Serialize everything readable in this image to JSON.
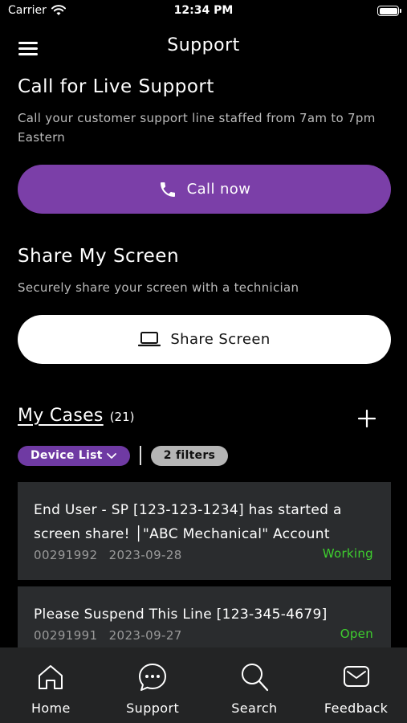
{
  "status_bar": {
    "carrier": "Carrier",
    "time": "12:34 PM"
  },
  "nav": {
    "title": "Support"
  },
  "live_support": {
    "title": "Call for Live Support",
    "description": "Call your customer support line staffed from 7am to 7pm Eastern",
    "button_label": "Call now"
  },
  "share_screen": {
    "title": "Share My Screen",
    "description": "Securely share your screen with a technician",
    "button_label": "Share Screen"
  },
  "cases": {
    "title": "My Cases",
    "count": "(21)",
    "filters": {
      "device_list": "Device List",
      "filter_count": "2 filters"
    },
    "items": [
      {
        "title": "End User - SP [123-123-1234] has started a screen share! │\"ABC Mechanical\" Account",
        "id": "00291992",
        "date": "2023-09-28",
        "status": "Working"
      },
      {
        "title": "Please Suspend This Line [123-345-4679]",
        "id": "00291991",
        "date": "2023-09-27",
        "status": "Open"
      }
    ]
  },
  "tabs": [
    {
      "label": "Home",
      "icon": "home-icon"
    },
    {
      "label": "Support",
      "icon": "chat-bubble-icon"
    },
    {
      "label": "Search",
      "icon": "search-icon"
    },
    {
      "label": "Feedback",
      "icon": "mail-icon"
    }
  ],
  "colors": {
    "accent": "#7b3fa8",
    "status_green": "#3ecf2e",
    "card_bg": "#2a2c2e",
    "tab_bg": "#232425"
  }
}
